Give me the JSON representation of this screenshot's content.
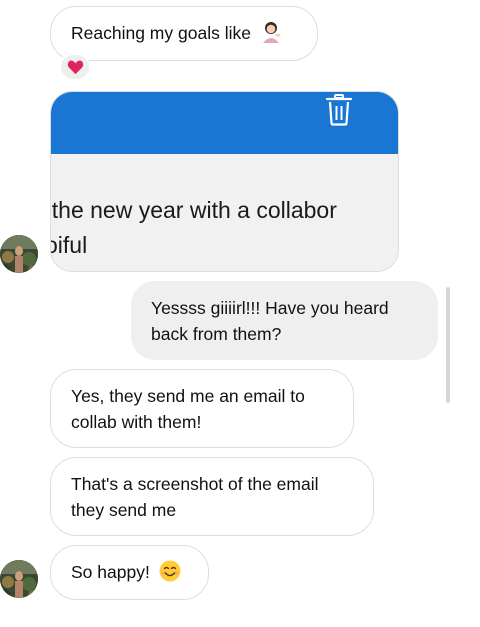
{
  "messages": {
    "m1": {
      "text": "Reaching my goals like",
      "emoji": "woman-tipping-hand-emoji"
    },
    "m1_reaction": "heart-emoji",
    "shared_post": {
      "line1": ": the new year with a collabor",
      "line2": "oiful"
    },
    "m2": {
      "line1": "Yessss giiiirl!!! Have you heard",
      "line2": "back from them?"
    },
    "m3": {
      "line1": "Yes, they send me an email to",
      "line2": "collab with them!"
    },
    "m4": {
      "line1": "That's a screenshot of the email",
      "line2": "they send me"
    },
    "m5": {
      "text": "So happy!",
      "emoji": "smiling-face-emoji"
    }
  },
  "colors": {
    "card_header": "#1976d2",
    "outgoing_bubble": "#efefef",
    "bubble_border": "#dedede",
    "heart": "#e0245e",
    "smile": "#ffcc33"
  }
}
